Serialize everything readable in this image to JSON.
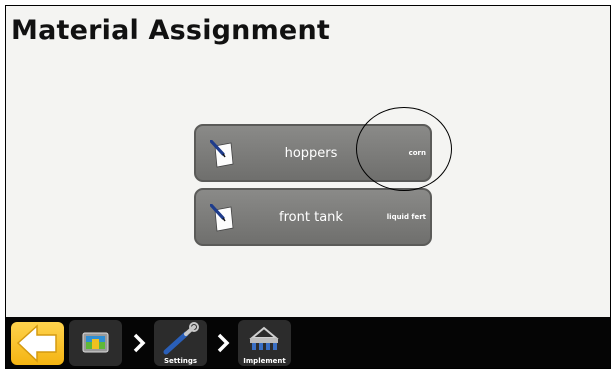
{
  "page": {
    "title": "Material Assignment"
  },
  "materials": [
    {
      "name": "hoppers",
      "material": "corn",
      "icon": "document-pencil-icon"
    },
    {
      "name": "front tank",
      "material": "liquid fert",
      "icon": "document-pencil-icon"
    }
  ],
  "toolbar": {
    "back_icon": "back-arrow-icon",
    "home_icon": "display-screen-icon",
    "settings_label": "Settings",
    "settings_icon": "wrench-icon",
    "implement_label": "Implement",
    "implement_icon": "implement-icon"
  },
  "colors": {
    "back_button": "#f4b412",
    "bar": "#050505",
    "material_button": "#7d7d7b"
  }
}
